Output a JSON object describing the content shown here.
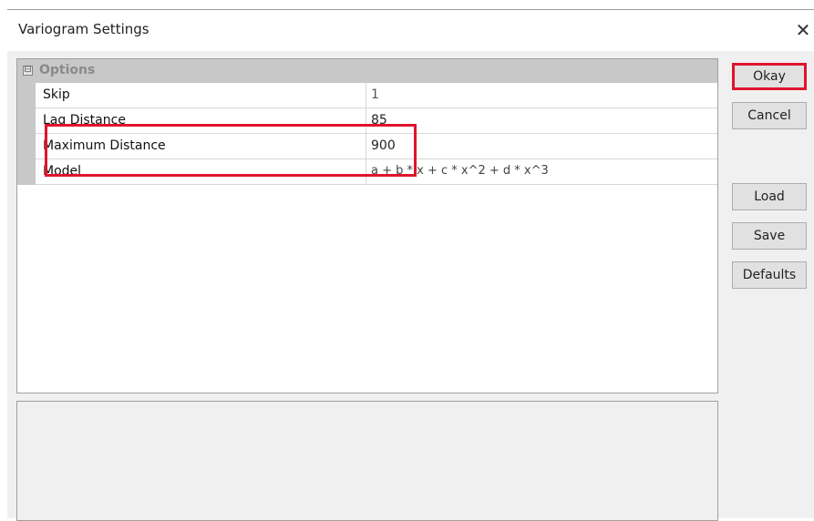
{
  "window": {
    "title": "Variogram Settings",
    "close_label": "✕"
  },
  "grid": {
    "category": {
      "toggle": "⊟",
      "label": "Options"
    },
    "rows": [
      {
        "name": "Skip",
        "value": "1"
      },
      {
        "name": "Lag Distance",
        "value": "85"
      },
      {
        "name": "Maximum Distance",
        "value": "900"
      },
      {
        "name": "Model",
        "value": "a + b * x + c * x^2 + d * x^3"
      }
    ]
  },
  "buttons": {
    "okay": "Okay",
    "cancel": "Cancel",
    "load": "Load",
    "save": "Save",
    "defaults": "Defaults"
  },
  "colors": {
    "highlight": "#e0142c",
    "category_bg": "#c8c8c8"
  }
}
